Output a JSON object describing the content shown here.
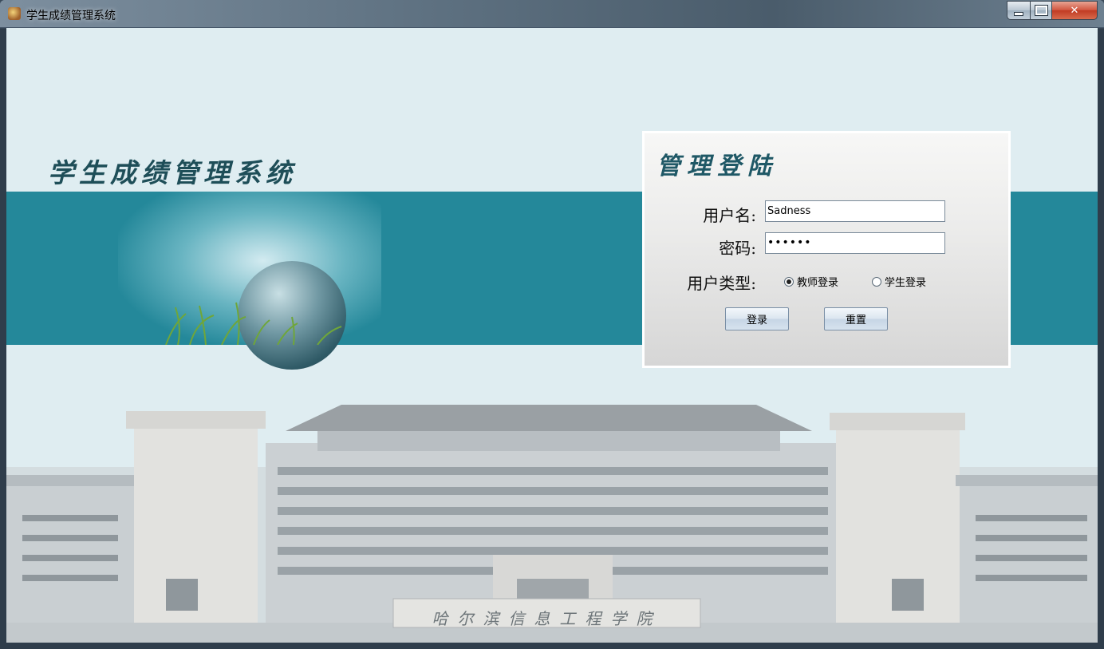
{
  "window": {
    "title": "学生成绩管理系统",
    "controls": {
      "minimize": "minimize",
      "maximize": "maximize",
      "close": "✕"
    }
  },
  "banner": {
    "system_title": "学生成绩管理系统",
    "campus_sign": "哈尔滨信息工程学院"
  },
  "login": {
    "title": "管理登陆",
    "username_label": "用户名:",
    "username_value": "Sadness",
    "password_label": "密码:",
    "password_value": "••••••",
    "usertype_label": "用户类型:",
    "radio_teacher": "教师登录",
    "radio_student": "学生登录",
    "selected": "教师登录",
    "login_button": "登录",
    "reset_button": "重置"
  },
  "colors": {
    "band": "#24889a",
    "background": "#dfedf1",
    "title_text": "#1e4e58"
  }
}
